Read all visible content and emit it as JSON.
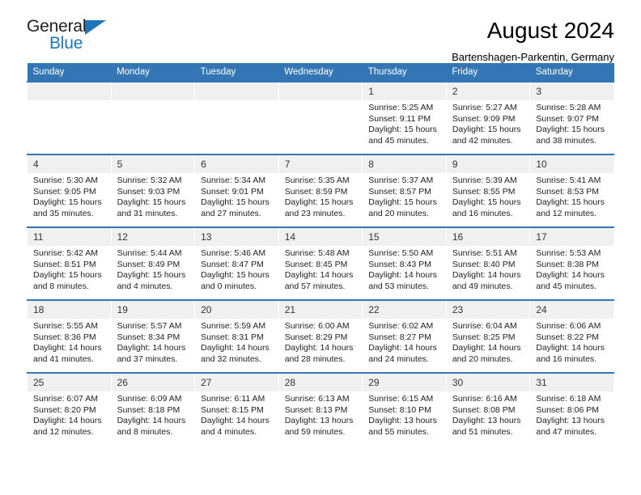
{
  "brand": {
    "name_top": "General",
    "name_bottom": "Blue",
    "accent_color": "#1b76bc"
  },
  "header": {
    "title": "August 2024",
    "subtitle": "Bartenshagen-Parkentin, Germany"
  },
  "theme": {
    "header_bar": "#3476b5",
    "daynum_bg": "#f0f0f0",
    "text": "#222222"
  },
  "weekday_headers": [
    "Sunday",
    "Monday",
    "Tuesday",
    "Wednesday",
    "Thursday",
    "Friday",
    "Saturday"
  ],
  "labels": {
    "sunrise_prefix": "Sunrise:",
    "sunset_prefix": "Sunset:",
    "daylight_prefix": "Daylight:"
  },
  "weeks": [
    [
      {
        "day": "",
        "empty": true
      },
      {
        "day": "",
        "empty": true
      },
      {
        "day": "",
        "empty": true
      },
      {
        "day": "",
        "empty": true
      },
      {
        "day": "1",
        "sunrise": "Sunrise: 5:25 AM",
        "sunset": "Sunset: 9:11 PM",
        "daylight_l1": "Daylight: 15 hours",
        "daylight_l2": "and 45 minutes."
      },
      {
        "day": "2",
        "sunrise": "Sunrise: 5:27 AM",
        "sunset": "Sunset: 9:09 PM",
        "daylight_l1": "Daylight: 15 hours",
        "daylight_l2": "and 42 minutes."
      },
      {
        "day": "3",
        "sunrise": "Sunrise: 5:28 AM",
        "sunset": "Sunset: 9:07 PM",
        "daylight_l1": "Daylight: 15 hours",
        "daylight_l2": "and 38 minutes."
      }
    ],
    [
      {
        "day": "4",
        "sunrise": "Sunrise: 5:30 AM",
        "sunset": "Sunset: 9:05 PM",
        "daylight_l1": "Daylight: 15 hours",
        "daylight_l2": "and 35 minutes."
      },
      {
        "day": "5",
        "sunrise": "Sunrise: 5:32 AM",
        "sunset": "Sunset: 9:03 PM",
        "daylight_l1": "Daylight: 15 hours",
        "daylight_l2": "and 31 minutes."
      },
      {
        "day": "6",
        "sunrise": "Sunrise: 5:34 AM",
        "sunset": "Sunset: 9:01 PM",
        "daylight_l1": "Daylight: 15 hours",
        "daylight_l2": "and 27 minutes."
      },
      {
        "day": "7",
        "sunrise": "Sunrise: 5:35 AM",
        "sunset": "Sunset: 8:59 PM",
        "daylight_l1": "Daylight: 15 hours",
        "daylight_l2": "and 23 minutes."
      },
      {
        "day": "8",
        "sunrise": "Sunrise: 5:37 AM",
        "sunset": "Sunset: 8:57 PM",
        "daylight_l1": "Daylight: 15 hours",
        "daylight_l2": "and 20 minutes."
      },
      {
        "day": "9",
        "sunrise": "Sunrise: 5:39 AM",
        "sunset": "Sunset: 8:55 PM",
        "daylight_l1": "Daylight: 15 hours",
        "daylight_l2": "and 16 minutes."
      },
      {
        "day": "10",
        "sunrise": "Sunrise: 5:41 AM",
        "sunset": "Sunset: 8:53 PM",
        "daylight_l1": "Daylight: 15 hours",
        "daylight_l2": "and 12 minutes."
      }
    ],
    [
      {
        "day": "11",
        "sunrise": "Sunrise: 5:42 AM",
        "sunset": "Sunset: 8:51 PM",
        "daylight_l1": "Daylight: 15 hours",
        "daylight_l2": "and 8 minutes."
      },
      {
        "day": "12",
        "sunrise": "Sunrise: 5:44 AM",
        "sunset": "Sunset: 8:49 PM",
        "daylight_l1": "Daylight: 15 hours",
        "daylight_l2": "and 4 minutes."
      },
      {
        "day": "13",
        "sunrise": "Sunrise: 5:46 AM",
        "sunset": "Sunset: 8:47 PM",
        "daylight_l1": "Daylight: 15 hours",
        "daylight_l2": "and 0 minutes."
      },
      {
        "day": "14",
        "sunrise": "Sunrise: 5:48 AM",
        "sunset": "Sunset: 8:45 PM",
        "daylight_l1": "Daylight: 14 hours",
        "daylight_l2": "and 57 minutes."
      },
      {
        "day": "15",
        "sunrise": "Sunrise: 5:50 AM",
        "sunset": "Sunset: 8:43 PM",
        "daylight_l1": "Daylight: 14 hours",
        "daylight_l2": "and 53 minutes."
      },
      {
        "day": "16",
        "sunrise": "Sunrise: 5:51 AM",
        "sunset": "Sunset: 8:40 PM",
        "daylight_l1": "Daylight: 14 hours",
        "daylight_l2": "and 49 minutes."
      },
      {
        "day": "17",
        "sunrise": "Sunrise: 5:53 AM",
        "sunset": "Sunset: 8:38 PM",
        "daylight_l1": "Daylight: 14 hours",
        "daylight_l2": "and 45 minutes."
      }
    ],
    [
      {
        "day": "18",
        "sunrise": "Sunrise: 5:55 AM",
        "sunset": "Sunset: 8:36 PM",
        "daylight_l1": "Daylight: 14 hours",
        "daylight_l2": "and 41 minutes."
      },
      {
        "day": "19",
        "sunrise": "Sunrise: 5:57 AM",
        "sunset": "Sunset: 8:34 PM",
        "daylight_l1": "Daylight: 14 hours",
        "daylight_l2": "and 37 minutes."
      },
      {
        "day": "20",
        "sunrise": "Sunrise: 5:59 AM",
        "sunset": "Sunset: 8:31 PM",
        "daylight_l1": "Daylight: 14 hours",
        "daylight_l2": "and 32 minutes."
      },
      {
        "day": "21",
        "sunrise": "Sunrise: 6:00 AM",
        "sunset": "Sunset: 8:29 PM",
        "daylight_l1": "Daylight: 14 hours",
        "daylight_l2": "and 28 minutes."
      },
      {
        "day": "22",
        "sunrise": "Sunrise: 6:02 AM",
        "sunset": "Sunset: 8:27 PM",
        "daylight_l1": "Daylight: 14 hours",
        "daylight_l2": "and 24 minutes."
      },
      {
        "day": "23",
        "sunrise": "Sunrise: 6:04 AM",
        "sunset": "Sunset: 8:25 PM",
        "daylight_l1": "Daylight: 14 hours",
        "daylight_l2": "and 20 minutes."
      },
      {
        "day": "24",
        "sunrise": "Sunrise: 6:06 AM",
        "sunset": "Sunset: 8:22 PM",
        "daylight_l1": "Daylight: 14 hours",
        "daylight_l2": "and 16 minutes."
      }
    ],
    [
      {
        "day": "25",
        "sunrise": "Sunrise: 6:07 AM",
        "sunset": "Sunset: 8:20 PM",
        "daylight_l1": "Daylight: 14 hours",
        "daylight_l2": "and 12 minutes."
      },
      {
        "day": "26",
        "sunrise": "Sunrise: 6:09 AM",
        "sunset": "Sunset: 8:18 PM",
        "daylight_l1": "Daylight: 14 hours",
        "daylight_l2": "and 8 minutes."
      },
      {
        "day": "27",
        "sunrise": "Sunrise: 6:11 AM",
        "sunset": "Sunset: 8:15 PM",
        "daylight_l1": "Daylight: 14 hours",
        "daylight_l2": "and 4 minutes."
      },
      {
        "day": "28",
        "sunrise": "Sunrise: 6:13 AM",
        "sunset": "Sunset: 8:13 PM",
        "daylight_l1": "Daylight: 13 hours",
        "daylight_l2": "and 59 minutes."
      },
      {
        "day": "29",
        "sunrise": "Sunrise: 6:15 AM",
        "sunset": "Sunset: 8:10 PM",
        "daylight_l1": "Daylight: 13 hours",
        "daylight_l2": "and 55 minutes."
      },
      {
        "day": "30",
        "sunrise": "Sunrise: 6:16 AM",
        "sunset": "Sunset: 8:08 PM",
        "daylight_l1": "Daylight: 13 hours",
        "daylight_l2": "and 51 minutes."
      },
      {
        "day": "31",
        "sunrise": "Sunrise: 6:18 AM",
        "sunset": "Sunset: 8:06 PM",
        "daylight_l1": "Daylight: 13 hours",
        "daylight_l2": "and 47 minutes."
      }
    ]
  ]
}
